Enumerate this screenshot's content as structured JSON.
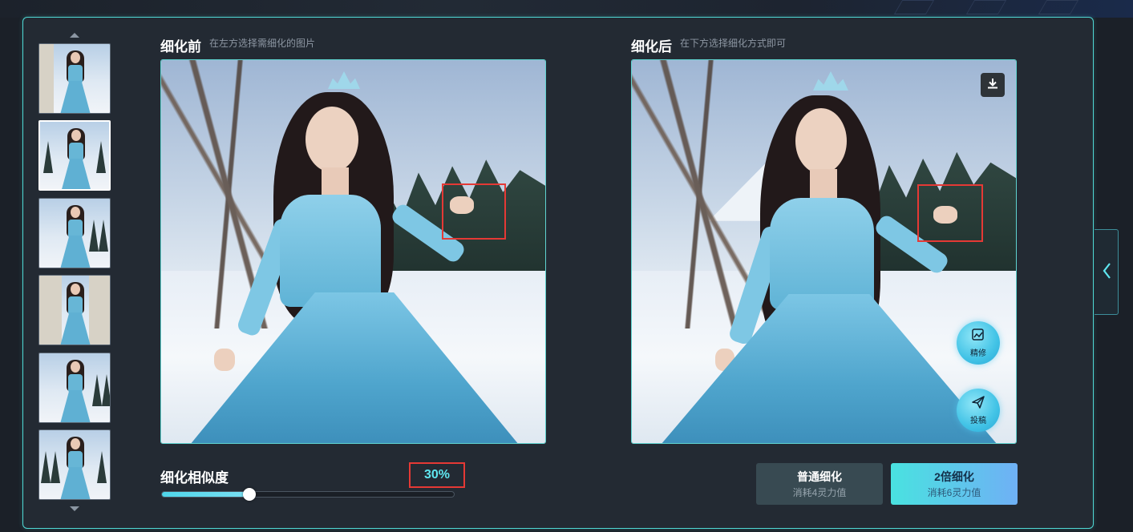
{
  "before": {
    "title": "细化前",
    "subtitle": "在左方选择需细化的图片"
  },
  "after": {
    "title": "细化后",
    "subtitle": "在下方选择细化方式即可",
    "download_icon": "download-icon",
    "refine_button_label": "精修",
    "submit_button_label": "投稿"
  },
  "thumbnails": {
    "count": 6,
    "selected_index": 1
  },
  "similarity": {
    "label": "细化相似度",
    "value_text": "30%",
    "value": 0.3
  },
  "actions": {
    "normal": {
      "label": "普通细化",
      "cost": "消耗4灵力值"
    },
    "double": {
      "label": "2倍细化",
      "cost": "消耗6灵力值"
    }
  },
  "colors": {
    "accent": "#4fd8d4",
    "highlight_box": "#e53935",
    "value_text": "#5fe7f0"
  }
}
